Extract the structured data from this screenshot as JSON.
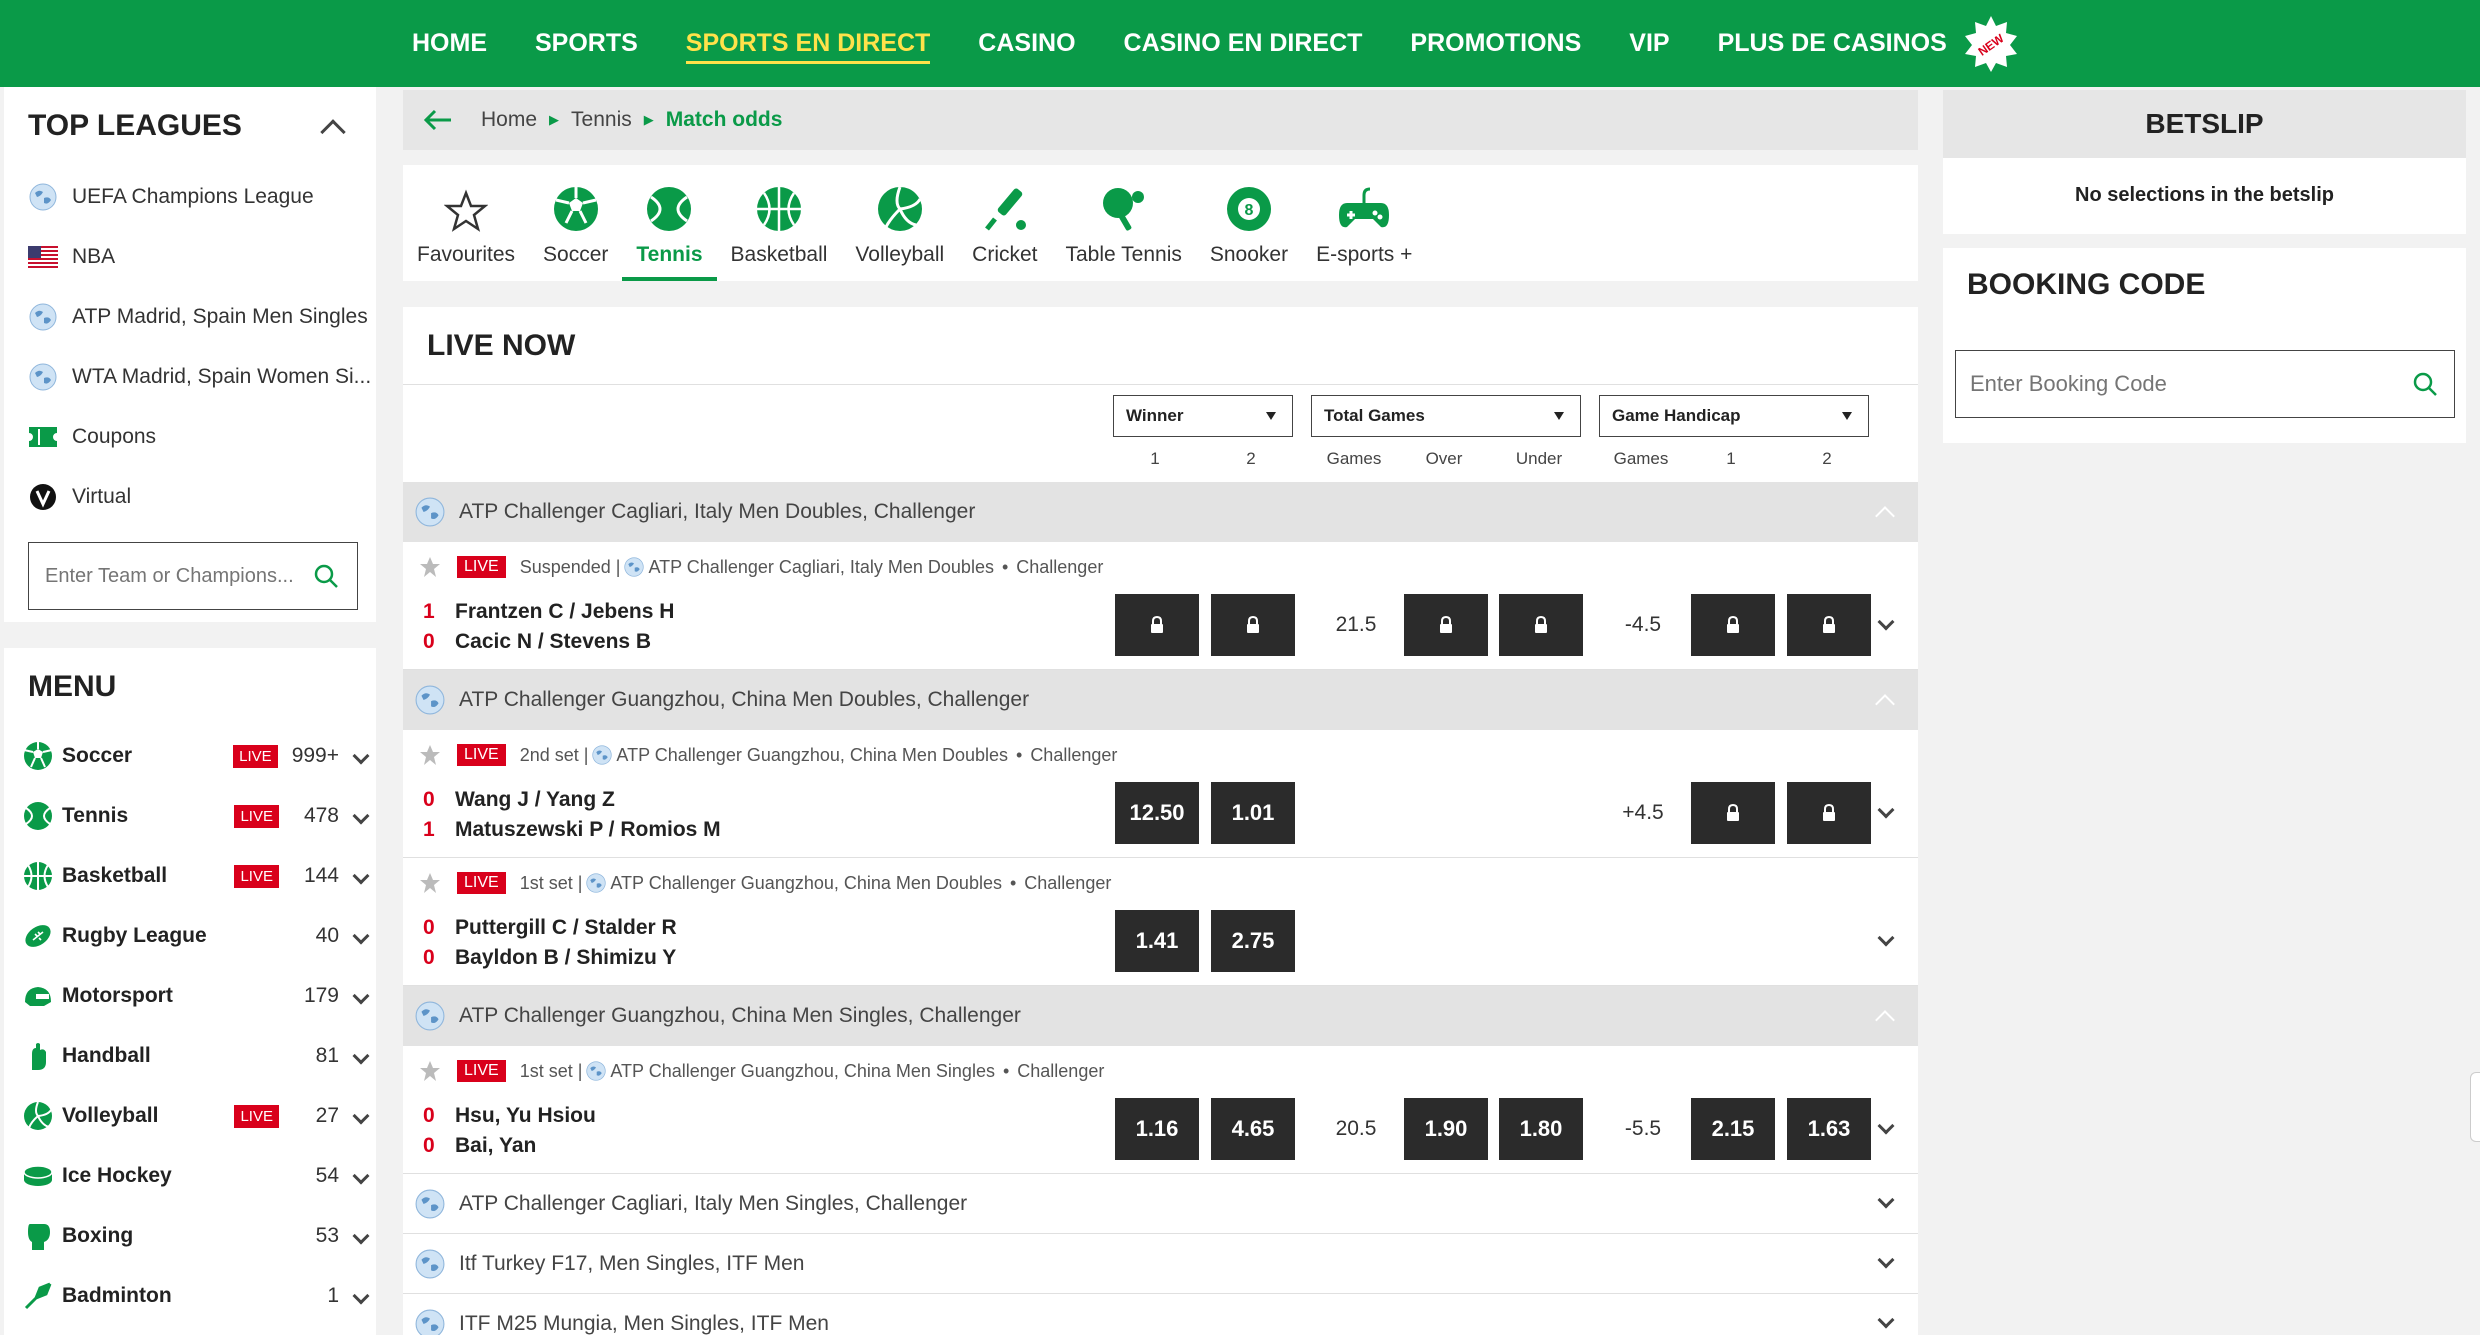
{
  "nav": {
    "items": [
      "HOME",
      "SPORTS",
      "SPORTS EN DIRECT",
      "CASINO",
      "CASINO EN DIRECT",
      "PROMOTIONS",
      "VIP",
      "PLUS DE CASINOS"
    ],
    "active_index": 2,
    "new_badge": "NEW"
  },
  "top_leagues": {
    "title": "TOP LEAGUES",
    "items": [
      {
        "label": "UEFA Champions League",
        "icon": "globe-icon"
      },
      {
        "label": "NBA",
        "icon": "us-flag-icon"
      },
      {
        "label": "ATP Madrid, Spain Men Singles",
        "icon": "globe-icon"
      },
      {
        "label": "WTA Madrid, Spain Women Si...",
        "icon": "globe-icon"
      },
      {
        "label": "Coupons",
        "icon": "ticket-icon"
      },
      {
        "label": "Virtual",
        "icon": "virtual-icon"
      }
    ],
    "search_placeholder": "Enter Team or Champions..."
  },
  "menu": {
    "title": "MENU",
    "live_label": "LIVE",
    "items": [
      {
        "label": "Soccer",
        "live": true,
        "count": "999+"
      },
      {
        "label": "Tennis",
        "live": true,
        "count": "478"
      },
      {
        "label": "Basketball",
        "live": true,
        "count": "144"
      },
      {
        "label": "Rugby League",
        "live": false,
        "count": "40"
      },
      {
        "label": "Motorsport",
        "live": false,
        "count": "179"
      },
      {
        "label": "Handball",
        "live": false,
        "count": "81"
      },
      {
        "label": "Volleyball",
        "live": true,
        "count": "27"
      },
      {
        "label": "Ice Hockey",
        "live": false,
        "count": "54"
      },
      {
        "label": "Boxing",
        "live": false,
        "count": "53"
      },
      {
        "label": "Badminton",
        "live": false,
        "count": "1"
      }
    ]
  },
  "breadcrumb": {
    "items": [
      "Home",
      "Tennis",
      "Match odds"
    ]
  },
  "sports_bar": {
    "items": [
      "Favourites",
      "Soccer",
      "Tennis",
      "Basketball",
      "Volleyball",
      "Cricket",
      "Table Tennis",
      "Snooker",
      "E-sports +"
    ],
    "active_index": 2
  },
  "live": {
    "title": "LIVE NOW",
    "markets": [
      "Winner",
      "Total Games",
      "Game Handicap"
    ],
    "col_headers": [
      "1",
      "2",
      "Games",
      "Over",
      "Under",
      "Games",
      "1",
      "2"
    ],
    "groups": [
      {
        "name": "ATP Challenger Cagliari, Italy Men Doubles, Challenger",
        "matches": [
          {
            "status": "Suspended |",
            "comp": "ATP Challenger Cagliari, Italy Men Doubles",
            "tier": "Challenger",
            "team1": "Frantzen C / Jebens H",
            "score1": "1",
            "team2": "Cacic N / Stevens B",
            "score2": "0",
            "winner1": "lock",
            "winner2": "lock",
            "games": "21.5",
            "over": "lock",
            "under": "lock",
            "hcp": "-4.5",
            "hcp1": "lock",
            "hcp2": "lock"
          }
        ]
      },
      {
        "name": "ATP Challenger Guangzhou, China Men Doubles, Challenger",
        "matches": [
          {
            "status": "2nd set |",
            "comp": "ATP Challenger Guangzhou, China Men Doubles",
            "tier": "Challenger",
            "team1": "Wang J / Yang Z",
            "score1": "0",
            "team2": "Matuszewski P / Romios M",
            "score2": "1",
            "winner1": "12.50",
            "winner2": "1.01",
            "games": "",
            "over": "",
            "under": "",
            "hcp": "+4.5",
            "hcp1": "lock",
            "hcp2": "lock"
          },
          {
            "status": "1st set |",
            "comp": "ATP Challenger Guangzhou, China Men Doubles",
            "tier": "Challenger",
            "team1": "Puttergill C / Stalder R",
            "score1": "0",
            "team2": "Bayldon B / Shimizu Y",
            "score2": "0",
            "winner1": "1.41",
            "winner2": "2.75",
            "games": "",
            "over": "",
            "under": "",
            "hcp": "",
            "hcp1": "",
            "hcp2": ""
          }
        ]
      },
      {
        "name": "ATP Challenger Guangzhou, China Men Singles, Challenger",
        "matches": [
          {
            "status": "1st set |",
            "comp": "ATP Challenger Guangzhou, China Men Singles",
            "tier": "Challenger",
            "team1": "Hsu, Yu Hsiou",
            "score1": "0",
            "team2": "Bai, Yan",
            "score2": "0",
            "winner1": "1.16",
            "winner2": "4.65",
            "games": "20.5",
            "over": "1.90",
            "under": "1.80",
            "hcp": "-5.5",
            "hcp1": "2.15",
            "hcp2": "1.63"
          }
        ]
      }
    ],
    "collapsed_groups": [
      "ATP Challenger Cagliari, Italy Men Singles, Challenger",
      "Itf Turkey F17, Men Singles, ITF Men",
      "ITF M25 Mungia, Men Singles, ITF Men"
    ]
  },
  "betslip": {
    "title": "BETSLIP",
    "empty_message": "No selections in the betslip"
  },
  "booking": {
    "title": "BOOKING CODE",
    "placeholder": "Enter Booking Code"
  },
  "colors": {
    "brand_green": "#0a9a48",
    "nav_active": "#ffe24a",
    "live_red": "#d9001b",
    "odds_bg": "#2b2b2b"
  }
}
